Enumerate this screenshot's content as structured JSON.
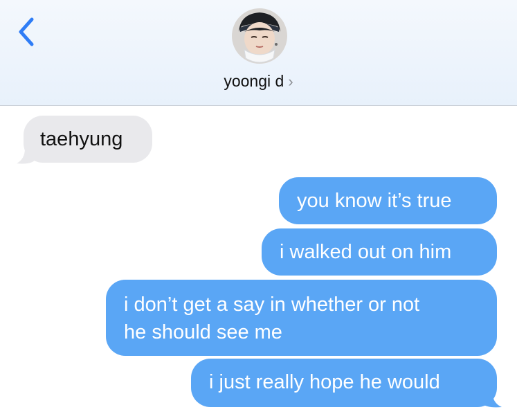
{
  "header": {
    "contact_name": "yoongi d",
    "chevron": "›",
    "back_icon": "chevron-left-icon",
    "accent": "#2f7df6"
  },
  "messages": [
    {
      "direction": "incoming",
      "text": "taehyung"
    },
    {
      "direction": "outgoing",
      "text": "you know it’s true"
    },
    {
      "direction": "outgoing",
      "text": "i walked out on him"
    },
    {
      "direction": "outgoing",
      "lines": [
        "i don’t get a say in whether or not",
        "he should see me"
      ]
    },
    {
      "direction": "outgoing",
      "text": "i just really hope he would"
    }
  ],
  "colors": {
    "incoming_bubble": "#e9e9ec",
    "outgoing_bubble": "#5aa6f5"
  }
}
